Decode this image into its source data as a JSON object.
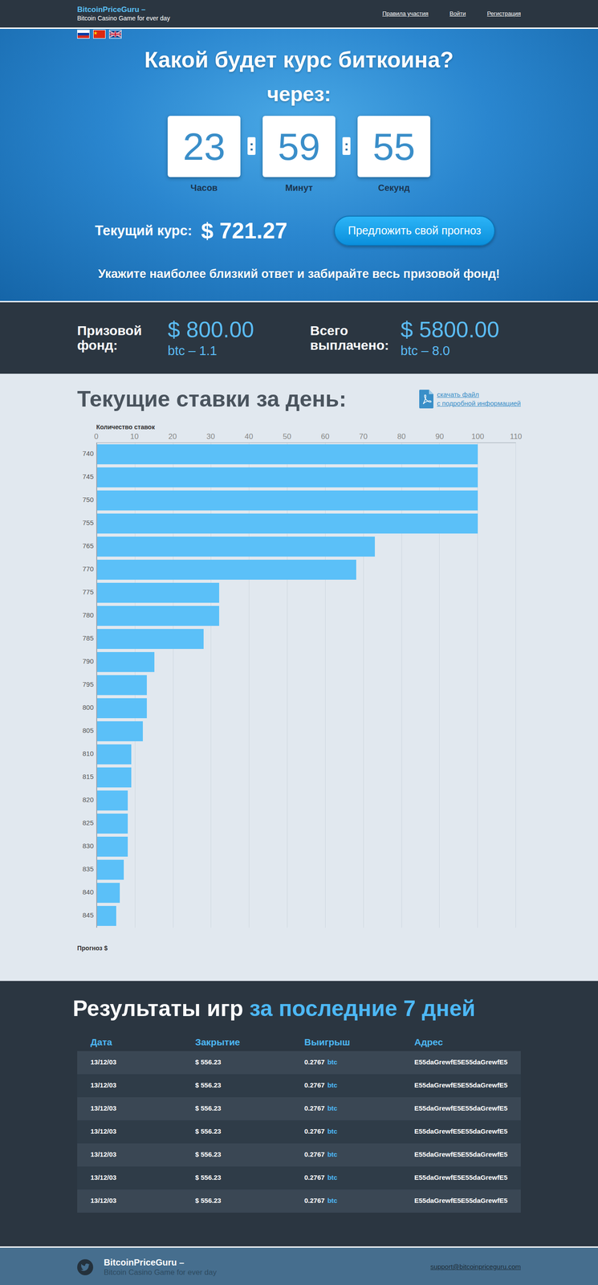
{
  "header": {
    "logo": "BitcoinPriceGuru –",
    "subtitle": "Bitcoin Casino Game for ever day",
    "nav": [
      "Правила участия",
      "Войти",
      "Регистрация"
    ]
  },
  "hero": {
    "title": "Какой будет курс биткоина?",
    "subtitle": "через:",
    "countdown": [
      {
        "value": "23",
        "label": "Часов"
      },
      {
        "value": "59",
        "label": "Минут"
      },
      {
        "value": "55",
        "label": "Секунд"
      }
    ],
    "separator": ":",
    "rate_label": "Текущий курс:",
    "rate": "$ 721.27",
    "button": "Предложить свой прогноз",
    "tagline": "Укажите наиболее близкий ответ и забирайте весь призовой фонд!"
  },
  "stats": [
    {
      "label": "Призовой фонд:",
      "usd": "$ 800.00",
      "btc": "btc – 1.1"
    },
    {
      "label": "Всего выплачено:",
      "usd": "$ 5800.00",
      "btc": "btc – 8.0"
    }
  ],
  "chart": {
    "title": "Текущие ставки за день:",
    "download": [
      "скачать файл",
      "с подробной информацией"
    ],
    "x_axis_title": "Количество ставок",
    "y_axis_title": "Прогноз $",
    "ticks": [
      "0",
      "10",
      "20",
      "30",
      "40",
      "50",
      "60",
      "70",
      "80",
      "90",
      "100",
      "110"
    ],
    "categories": [
      "740",
      "745",
      "750",
      "755",
      "765",
      "770",
      "775",
      "780",
      "785",
      "790",
      "795",
      "800",
      "805",
      "810",
      "815",
      "820",
      "825",
      "830",
      "835",
      "840",
      "845"
    ],
    "values": [
      100,
      100,
      100,
      100,
      73,
      68,
      32,
      32,
      28,
      15,
      13,
      13,
      12,
      9,
      9,
      8,
      8,
      8,
      7,
      6,
      5
    ]
  },
  "results": {
    "title": "Результаты игр",
    "title_highlight": "за последние 7 дней",
    "columns": [
      "Дата",
      "Закрытие",
      "Выигрыш",
      "Адрес"
    ],
    "rows": [
      [
        "13/12/03",
        "$ 556.23",
        "0.2767",
        "btc",
        "E55daGrewfE5E55daGrewfE5"
      ],
      [
        "13/12/03",
        "$ 556.23",
        "0.2767",
        "btc",
        "E55daGrewfE5E55daGrewfE5"
      ],
      [
        "13/12/03",
        "$ 556.23",
        "0.2767",
        "btc",
        "E55daGrewfE5E55daGrewfE5"
      ],
      [
        "13/12/03",
        "$ 556.23",
        "0.2767",
        "btc",
        "E55daGrewfE5E55daGrewfE5"
      ],
      [
        "13/12/03",
        "$ 556.23",
        "0.2767",
        "btc",
        "E55daGrewfE5E55daGrewfE5"
      ],
      [
        "13/12/03",
        "$ 556.23",
        "0.2767",
        "btc",
        "E55daGrewfE5E55daGrewfE5"
      ],
      [
        "13/12/03",
        "$ 556.23",
        "0.2767",
        "btc",
        "E55daGrewfE5E55daGrewfE5"
      ]
    ]
  },
  "footer": {
    "logo": "BitcoinPriceGuru –",
    "subtitle": "Bitcoin Casino Game for ever day",
    "email": "support@bitcoinpriceguru.com"
  }
}
